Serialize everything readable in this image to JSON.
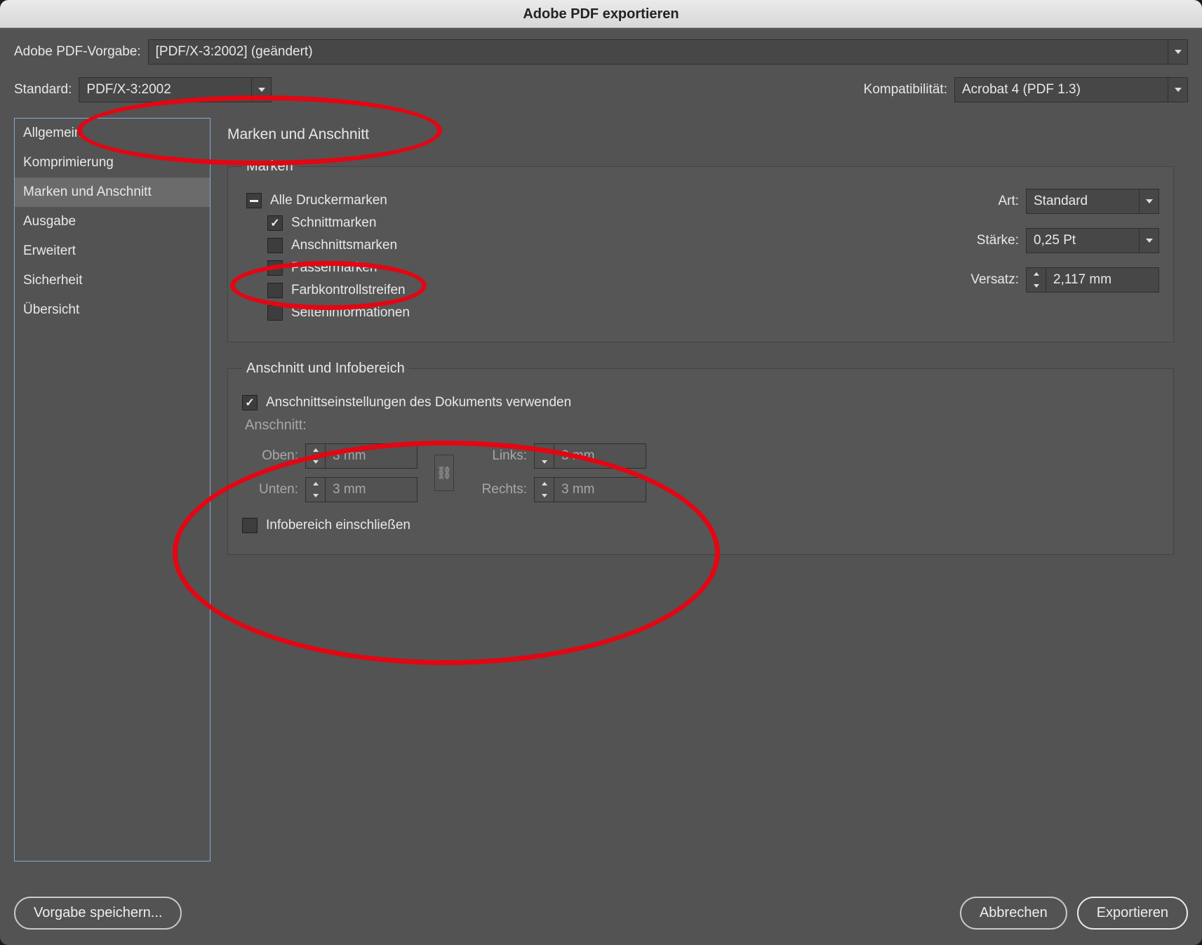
{
  "window": {
    "title": "Adobe PDF exportieren"
  },
  "top": {
    "preset_label": "Adobe PDF-Vorgabe:",
    "preset_value": "[PDF/X-3:2002] (geändert)",
    "standard_label": "Standard:",
    "standard_value": "PDF/X-3:2002",
    "compat_label": "Kompatibilität:",
    "compat_value": "Acrobat 4 (PDF 1.3)"
  },
  "sidebar": {
    "items": [
      {
        "label": "Allgemein"
      },
      {
        "label": "Komprimierung"
      },
      {
        "label": "Marken und Anschnitt"
      },
      {
        "label": "Ausgabe"
      },
      {
        "label": "Erweitert"
      },
      {
        "label": "Sicherheit"
      },
      {
        "label": "Übersicht"
      }
    ]
  },
  "panel": {
    "title": "Marken und Anschnitt",
    "marks": {
      "legend": "Marken",
      "all_label": "Alle Druckermarken",
      "crop_label": "Schnittmarken",
      "bleedmark_label": "Anschnittsmarken",
      "reg_label": "Passermarken",
      "color_label": "Farbkontrollstreifen",
      "page_label": "Seiteninformationen",
      "type_label": "Art:",
      "type_value": "Standard",
      "weight_label": "Stärke:",
      "weight_value": "0,25 Pt",
      "offset_label": "Versatz:",
      "offset_value": "2,117 mm"
    },
    "bleed": {
      "legend": "Anschnitt und Infobereich",
      "usedoc_label": "Anschnittseinstellungen des Dokuments verwenden",
      "sub_label": "Anschnitt:",
      "top_label": "Oben:",
      "top_value": "3 mm",
      "bottom_label": "Unten:",
      "bottom_value": "3 mm",
      "left_label": "Links:",
      "left_value": "3 mm",
      "right_label": "Rechts:",
      "right_value": "3 mm",
      "slug_label": "Infobereich einschließen"
    }
  },
  "footer": {
    "save_preset": "Vorgabe speichern...",
    "cancel": "Abbrechen",
    "export": "Exportieren"
  }
}
